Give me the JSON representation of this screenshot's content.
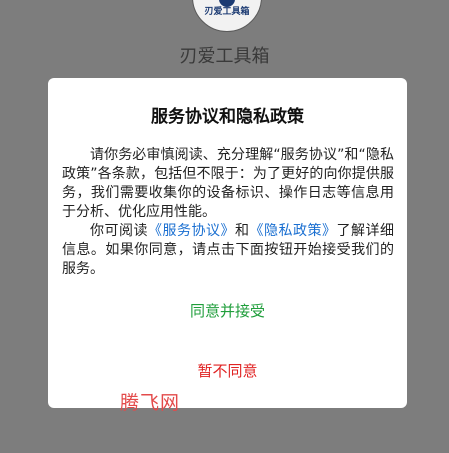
{
  "app": {
    "logo_text": "刃爱工具箱",
    "name": "刃爱工具箱"
  },
  "dialog": {
    "title": "服务协议和隐私政策",
    "paragraph1": "请你务必审慎阅读、充分理解“服务协议”和“隐私政策”各条款，包括但不限于：为了更好的向你提供服务，我们需要收集你的设备标识、操作日志等信息用于分析、优化应用性能。",
    "paragraph2_prefix": "你可阅读",
    "service_link": "《服务协议》",
    "and_text": "和",
    "privacy_link": "《隐私政策》",
    "paragraph2_suffix": "了解详细信息。如果你同意，请点击下面按钮开始接受我们的服务。",
    "agree_label": "同意并接受",
    "disagree_label": "暂不同意"
  },
  "watermark": "腾飞网",
  "colors": {
    "overlay": "#7d7d7d",
    "agree": "#1f9e3b",
    "disagree": "#e02222",
    "link": "#1a6fd1",
    "watermark": "#e34a4a"
  }
}
